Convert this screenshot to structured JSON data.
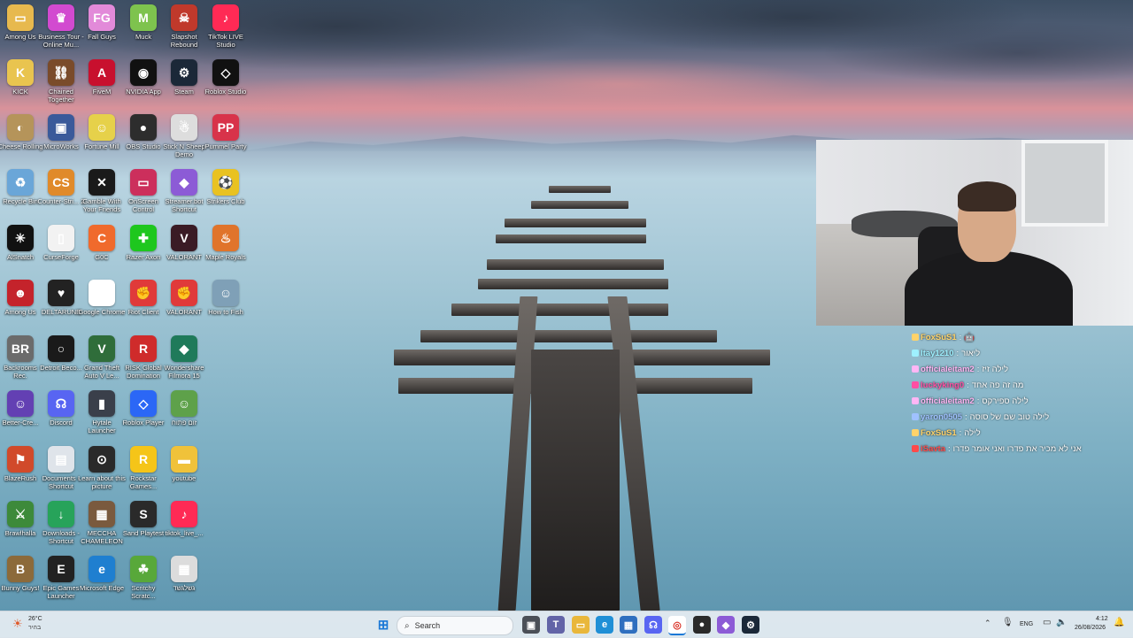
{
  "desktop": {
    "icons": [
      {
        "label": "Among Us",
        "color": "#e7b94e",
        "glyph": "▭"
      },
      {
        "label": "Business Tour - Online Mu...",
        "color": "#d24ad0",
        "glyph": "♛"
      },
      {
        "label": "Fall Guys",
        "color": "#e28ad9",
        "glyph": "FG"
      },
      {
        "label": "Muck",
        "color": "#7ec34e",
        "glyph": "M"
      },
      {
        "label": "Slapshot Rebound",
        "color": "#c0392b",
        "glyph": "☠"
      },
      {
        "label": "TikTok LIVE Studio",
        "color": "#ff2a55",
        "glyph": "♪"
      },
      {
        "label": "KICK",
        "color": "#e9c44f",
        "glyph": "K"
      },
      {
        "label": "Chained Together",
        "color": "#7a4b2a",
        "glyph": "⛓"
      },
      {
        "label": "FiveM",
        "color": "#c8102e",
        "glyph": "A"
      },
      {
        "label": "NVIDIA App",
        "color": "#111111",
        "glyph": "◉"
      },
      {
        "label": "Steam",
        "color": "#1b2838",
        "glyph": "⚙"
      },
      {
        "label": "Roblox Studio",
        "color": "#111111",
        "glyph": "◇"
      },
      {
        "label": "Cheese Rolling",
        "color": "#b5945a",
        "glyph": "◐"
      },
      {
        "label": "MicroWorks",
        "color": "#3a5a9a",
        "glyph": "▣"
      },
      {
        "label": "Fortune Mill",
        "color": "#e6d14a",
        "glyph": "☺"
      },
      {
        "label": "OBS Studio",
        "color": "#2d2d2d",
        "glyph": "●"
      },
      {
        "label": "Stick N Sheep Demo",
        "color": "#dddddd",
        "glyph": "☃"
      },
      {
        "label": "Pummel Party",
        "color": "#d8334a",
        "glyph": "PP"
      },
      {
        "label": "Recycle Bin",
        "color": "#6aa6d8",
        "glyph": "♻"
      },
      {
        "label": "Counter-Stri... 2",
        "color": "#e08a2a",
        "glyph": "CS"
      },
      {
        "label": "Gamble With Your Friends",
        "color": "#1a1a1a",
        "glyph": "✕"
      },
      {
        "label": "OnScreen Control",
        "color": "#cc2f5c",
        "glyph": "▭"
      },
      {
        "label": "Streamer.bot Shortcut",
        "color": "#8c5bd6",
        "glyph": "◆"
      },
      {
        "label": "Strikers Club",
        "color": "#e9c221",
        "glyph": "⚽"
      },
      {
        "label": "AlSnatch",
        "color": "#111111",
        "glyph": "✳"
      },
      {
        "label": "CurseForge",
        "color": "#f2f2f2",
        "glyph": "▯"
      },
      {
        "label": "G0C",
        "color": "#f06a2c",
        "glyph": "C"
      },
      {
        "label": "Razer Axon",
        "color": "#1ec71e",
        "glyph": "✚"
      },
      {
        "label": "VALORANT",
        "color": "#3a1b25",
        "glyph": "V"
      },
      {
        "label": "Maple Royals",
        "color": "#e0742b",
        "glyph": "♨"
      },
      {
        "label": "Among Us",
        "color": "#c4232b",
        "glyph": "☻"
      },
      {
        "label": "DELTARUNE",
        "color": "#222222",
        "glyph": "♥"
      },
      {
        "label": "Google Chrome",
        "color": "#ffffff",
        "glyph": "◎"
      },
      {
        "label": "Riot Client",
        "color": "#e03a3a",
        "glyph": "✊"
      },
      {
        "label": "VALORANT",
        "color": "#e03a3a",
        "glyph": "✊"
      },
      {
        "label": "How to Fish",
        "color": "#7fa0b7",
        "glyph": "☺"
      },
      {
        "label": "Backrooms Rec.",
        "color": "#6b6b6b",
        "glyph": "BR"
      },
      {
        "label": "Detroit Beco...",
        "color": "#1a1a1a",
        "glyph": "○"
      },
      {
        "label": "Grand Theft Auto V Le...",
        "color": "#2f6d3a",
        "glyph": "V"
      },
      {
        "label": "RISK Global Domination",
        "color": "#cf2b2b",
        "glyph": "R"
      },
      {
        "label": "Wondershare Filmora 15",
        "color": "#1f7a5a",
        "glyph": "◆"
      },
      {
        "label": "Better-Cre...",
        "color": "#6340b3",
        "glyph": "☺"
      },
      {
        "label": "Discord",
        "color": "#5865f2",
        "glyph": "☊"
      },
      {
        "label": "Hytale Launcher",
        "color": "#3a3f4a",
        "glyph": "▮"
      },
      {
        "label": "Roblox Player",
        "color": "#2b67f6",
        "glyph": "◇"
      },
      {
        "label": "זום פתוח",
        "color": "#5ea14a",
        "glyph": "☺"
      },
      {
        "label": "BlazeRush",
        "color": "#d14a2a",
        "glyph": "⚑"
      },
      {
        "label": "Documents - Shortcut",
        "color": "#dfe4ea",
        "glyph": "▤"
      },
      {
        "label": "Learn about this picture",
        "color": "#2a2a2a",
        "glyph": "⊙"
      },
      {
        "label": "Rockstar Games...",
        "color": "#f5c518",
        "glyph": "R"
      },
      {
        "label": "youtube",
        "color": "#f0c23a",
        "glyph": "▬"
      },
      {
        "label": "Brawlhalla",
        "color": "#3d8a3a",
        "glyph": "⚔"
      },
      {
        "label": "Downloads - Shortcut",
        "color": "#27a35a",
        "glyph": "↓"
      },
      {
        "label": "MECCHA CHAMELEON",
        "color": "#7a5a3e",
        "glyph": "▦"
      },
      {
        "label": "Sand Playtest",
        "color": "#2a2a2a",
        "glyph": "S"
      },
      {
        "label": "tiktok_live_...",
        "color": "#ff2a55",
        "glyph": "♪"
      },
      {
        "label": "Bunny Guys!",
        "color": "#8c6a3a",
        "glyph": "B"
      },
      {
        "label": "Epic Games Launcher",
        "color": "#222222",
        "glyph": "E"
      },
      {
        "label": "Microsoft Edge",
        "color": "#1f7fd0",
        "glyph": "e"
      },
      {
        "label": "Scritchy Scratc...",
        "color": "#58a83a",
        "glyph": "☘"
      },
      {
        "label": "גשלגשד",
        "color": "#dcdcdc",
        "glyph": "▦"
      }
    ]
  },
  "chat": {
    "messages": [
      {
        "user": "FoxSuS1",
        "user_color": "#ffd36a",
        "text": "🤖"
      },
      {
        "user": "Itay1210",
        "user_color": "#9ef0ff",
        "text": "ליאור"
      },
      {
        "user": "officialeitam2",
        "user_color": "#ffb6f5",
        "text": "לילה זיז"
      },
      {
        "user": "luckyking0",
        "user_color": "#ff4fa3",
        "text": "מה זה פה אחד"
      },
      {
        "user": "officialeitam2",
        "user_color": "#ffb6f5",
        "text": "לילה ספירקס"
      },
      {
        "user": "yaron0505",
        "user_color": "#9fc1ff",
        "text": "לילה טוב שם של סוסה"
      },
      {
        "user": "FoxSuS1",
        "user_color": "#ffd36a",
        "text": "לילה"
      },
      {
        "user": "iSavta",
        "user_color": "#ff4a4a",
        "text": "אני לא מכיר את פדרו ואני אומר פדרו"
      }
    ]
  },
  "taskbar": {
    "weather_temp": "26°C",
    "weather_desc": "בהיר",
    "search_placeholder": "Search",
    "lang": "ENG",
    "time": "4:12",
    "date": "26/08/2026"
  }
}
